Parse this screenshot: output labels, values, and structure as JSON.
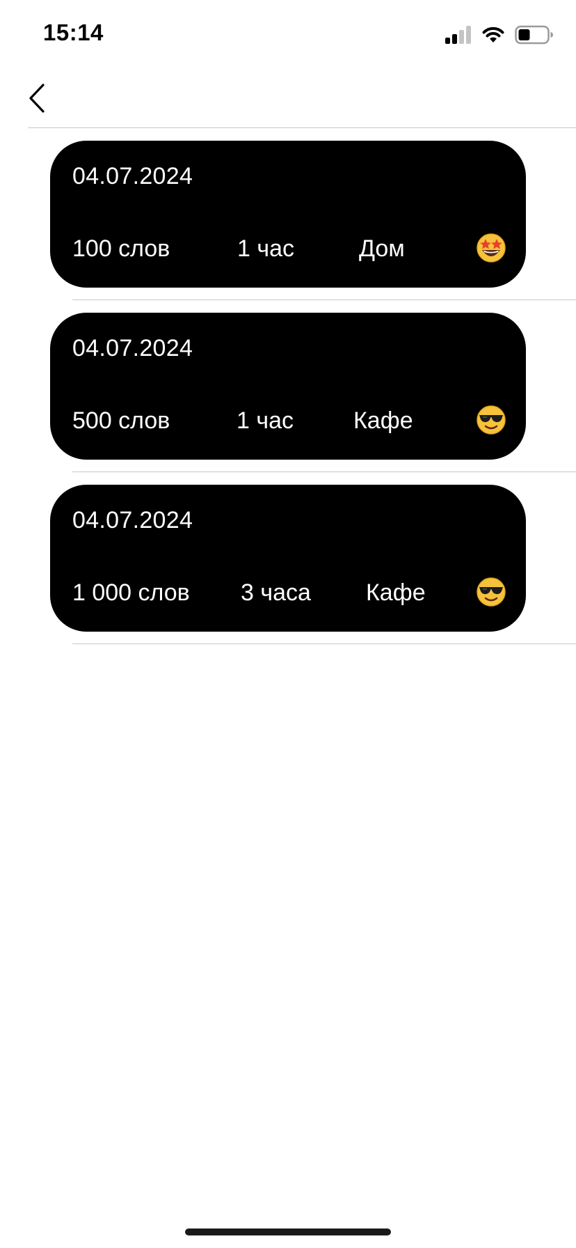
{
  "status_bar": {
    "time": "15:14",
    "icons": [
      "signal-icon",
      "wifi-icon",
      "battery-icon"
    ]
  },
  "nav": {
    "back_icon": "chevron-left-icon"
  },
  "entries": [
    {
      "date": "04.07.2024",
      "words": "100 слов",
      "duration": "1 час",
      "place": "Дом",
      "mood_icon": "star-struck-emoji-icon"
    },
    {
      "date": "04.07.2024",
      "words": "500 слов",
      "duration": "1 час",
      "place": "Кафе",
      "mood_icon": "sunglasses-emoji-icon"
    },
    {
      "date": "04.07.2024",
      "words": "1 000 слов",
      "duration": "3 часа",
      "place": "Кафе",
      "mood_icon": "sunglasses-emoji-icon"
    }
  ],
  "colors": {
    "card_background": "#000000",
    "card_text": "#ffffff",
    "divider": "#c8c8c8",
    "emoji_face": "#f7c23b"
  }
}
